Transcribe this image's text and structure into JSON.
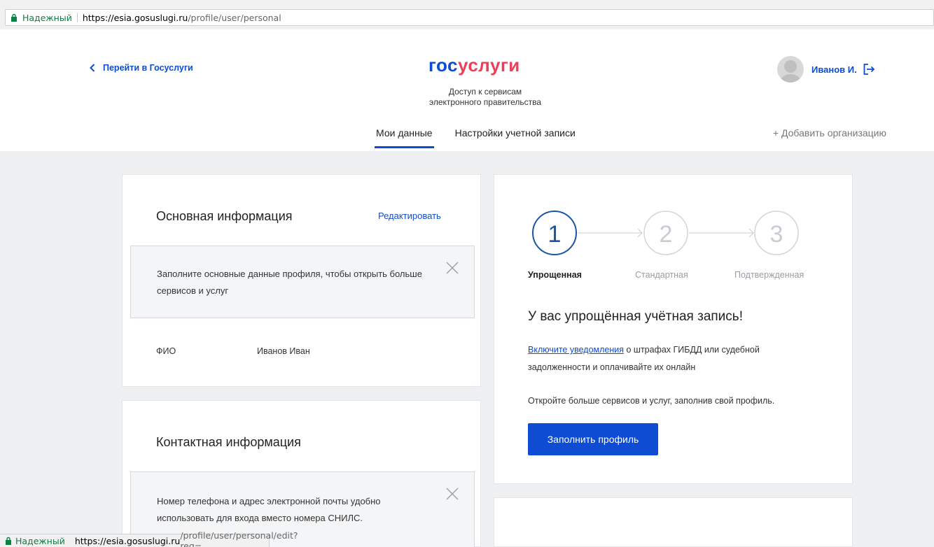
{
  "browser": {
    "secure_label": "Надежный",
    "url_host": "https://esia.gosuslugi.ru",
    "url_path": "/profile/user/personal"
  },
  "header": {
    "back_label": "Перейти в Госуслуги",
    "logo_part1": "гос",
    "logo_part2": "услуги",
    "tagline_line1": "Доступ к сервисам",
    "tagline_line2": "электронного правительства",
    "user_name": "Иванов И.",
    "tabs": [
      {
        "label": "Мои данные",
        "active": true
      },
      {
        "label": "Настройки учетной записи",
        "active": false
      }
    ],
    "add_org": "+ Добавить организацию"
  },
  "basic_info": {
    "title": "Основная информация",
    "edit_label": "Редактировать",
    "notice": "Заполните основные данные профиля, чтобы открыть больше сервисов и услуг",
    "fio_label": "ФИО",
    "fio_value": "Иванов Иван"
  },
  "contact_info": {
    "title": "Контактная информация",
    "notice": "Номер телефона и адрес электронной почты удобно использовать для входа вместо номера СНИЛС."
  },
  "account_status": {
    "steps": [
      {
        "number": "1",
        "label": "Упрощенная",
        "active": true
      },
      {
        "number": "2",
        "label": "Стандартная",
        "active": false
      },
      {
        "number": "3",
        "label": "Подтвержденная",
        "active": false
      }
    ],
    "heading": "У вас упрощённая учётная запись!",
    "link_text": "Включите уведомления",
    "text_after_link": " о штрафах ГИБДД или судебной задолженности и оплачивайте их онлайн",
    "text2": "Откройте больше сервисов и услуг, заполнив свой профиль.",
    "button_label": "Заполнить профиль"
  },
  "statusbar": {
    "secure_label": "Надежный",
    "url_host": "https://esia.gosuslugi.ru",
    "url_path": "/profile/user/personal/edit?req="
  },
  "colors": {
    "brand_blue": "#0d4cd3",
    "brand_red": "#ee3f58",
    "secure_green": "#0b8043",
    "background": "#eef0f2"
  }
}
